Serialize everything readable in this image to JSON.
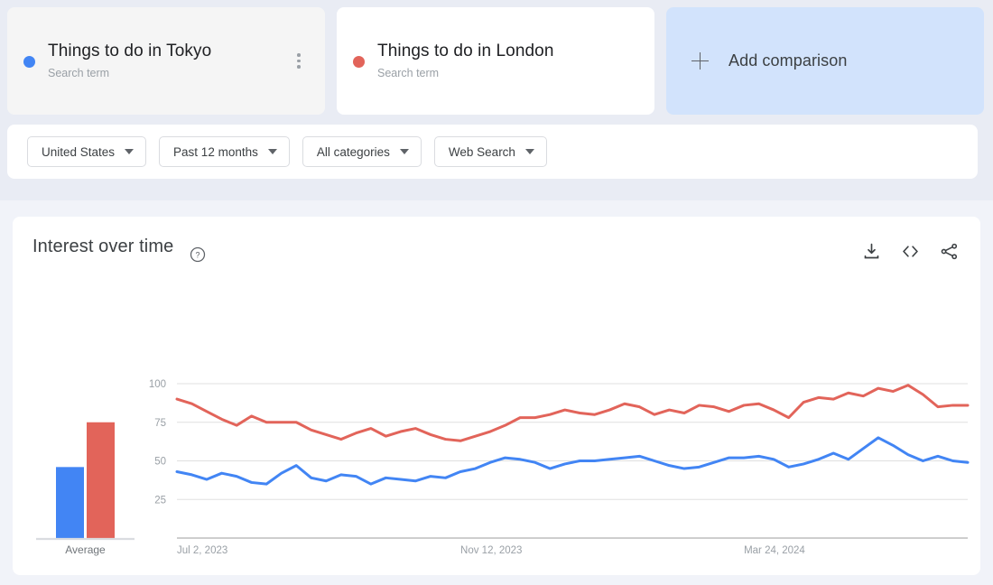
{
  "terms": [
    {
      "title": "Things to do in Tokyo",
      "subtitle": "Search term",
      "color": "#4285F4",
      "selected": true,
      "menu_icon": "kebab-menu-icon"
    },
    {
      "title": "Things to do in London",
      "subtitle": "Search term",
      "color": "#E2645A",
      "selected": false
    }
  ],
  "add_comparison": {
    "label": "Add comparison",
    "icon": "plus-icon"
  },
  "filters": [
    {
      "label": "United States"
    },
    {
      "label": "Past 12 months"
    },
    {
      "label": "All categories"
    },
    {
      "label": "Web Search"
    }
  ],
  "chart_panel": {
    "title": "Interest over time",
    "help_icon": "help-circle-icon",
    "actions": [
      {
        "name": "download-icon",
        "tooltip": "Download"
      },
      {
        "name": "embed-code-icon",
        "tooltip": "Embed"
      },
      {
        "name": "share-icon",
        "tooltip": "Share"
      }
    ]
  },
  "chart_data": {
    "type": "line",
    "title": "Interest over time",
    "xlabel": "",
    "ylabel": "",
    "ylim": [
      0,
      100
    ],
    "yticks": [
      25,
      50,
      75,
      100
    ],
    "ytick_labels": [
      "25",
      "50",
      "75",
      "100"
    ],
    "grid": true,
    "legend_position": "cards-above-chart",
    "xtick_labels": [
      "Jul 2, 2023",
      "Nov 12, 2023",
      "Mar 24, 2024"
    ],
    "xtick_positions": [
      0,
      19,
      38
    ],
    "n_points": 53,
    "series": [
      {
        "name": "Things to do in Tokyo",
        "color": "#4285F4",
        "average": 46,
        "values": [
          43,
          41,
          38,
          42,
          40,
          36,
          35,
          42,
          47,
          39,
          37,
          41,
          40,
          35,
          39,
          38,
          37,
          40,
          39,
          43,
          45,
          49,
          52,
          51,
          49,
          45,
          48,
          50,
          50,
          51,
          52,
          53,
          50,
          47,
          45,
          46,
          49,
          52,
          52,
          53,
          51,
          46,
          48,
          51,
          55,
          51,
          58,
          65,
          60,
          54,
          50,
          53,
          50,
          49
        ]
      },
      {
        "name": "Things to do in London",
        "color": "#E2645A",
        "average": 75,
        "values": [
          90,
          87,
          82,
          77,
          73,
          79,
          75,
          75,
          75,
          70,
          67,
          64,
          68,
          71,
          66,
          69,
          71,
          67,
          64,
          63,
          66,
          69,
          73,
          78,
          78,
          80,
          83,
          81,
          80,
          83,
          87,
          85,
          80,
          83,
          81,
          86,
          85,
          82,
          86,
          87,
          83,
          78,
          88,
          91,
          90,
          94,
          92,
          97,
          95,
          99,
          93,
          85,
          86,
          86
        ]
      }
    ],
    "average_bars": {
      "label": "Average",
      "values": [
        46,
        75
      ]
    }
  },
  "colors": {
    "blue": "#4285F4",
    "red": "#E2645A",
    "page_background": "#f1f3f9",
    "top_band": "#e9ecf4",
    "card_background": "#ffffff",
    "selected_card": "#f5f5f5",
    "add_card": "#d2e3fc"
  }
}
